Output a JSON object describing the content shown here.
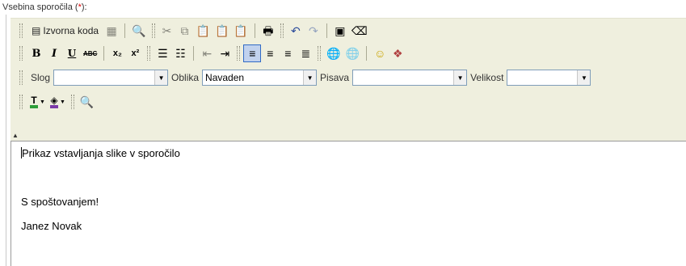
{
  "field": {
    "label": "Vsebina sporočila (",
    "required_mark": "*",
    "label_end": "):"
  },
  "toolbar": {
    "row1": {
      "source_label": "Izvorna koda",
      "icons": [
        "source-icon",
        "templates-icon",
        "preview-icon",
        "cut-icon",
        "copy-icon",
        "paste-icon",
        "paste-text-icon",
        "paste-word-icon",
        "print-icon",
        "undo-icon",
        "redo-icon",
        "select-all-icon",
        "remove-format-icon"
      ]
    },
    "row2": {
      "bold": "B",
      "italic": "I",
      "underline": "U",
      "strike": "ABC",
      "subscript": "x₂",
      "superscript": "x²"
    },
    "row3": {
      "style_label": "Slog",
      "style_value": "",
      "format_label": "Oblika",
      "format_value": "Navaden",
      "font_label": "Pisava",
      "font_value": "",
      "size_label": "Velikost",
      "size_value": ""
    }
  },
  "editor": {
    "lines": [
      "Prikaz vstavljanja slike v sporočilo",
      "",
      "S spoštovanjem!",
      "Janez Novak"
    ]
  }
}
